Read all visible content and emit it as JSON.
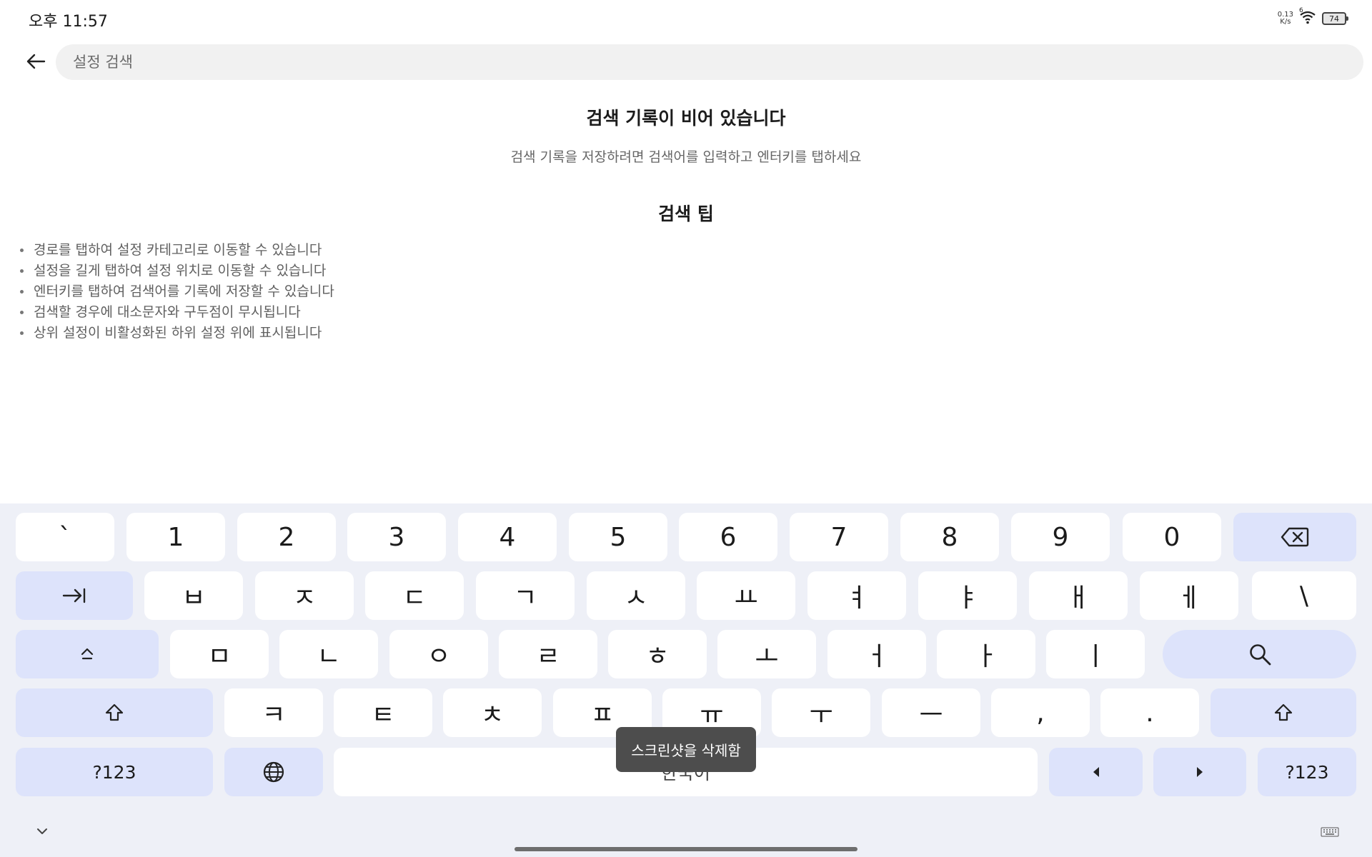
{
  "status_bar": {
    "time": "오후 11:57",
    "net_speed_value": "0.13",
    "net_speed_unit": "K/s",
    "wifi_badge": "6",
    "battery": "74"
  },
  "search": {
    "placeholder": "설정 검색"
  },
  "empty_state": {
    "title": "검색 기록이 비어 있습니다",
    "subtitle": "검색 기록을 저장하려면 검색어를 입력하고 엔터키를 탭하세요"
  },
  "tips": {
    "title": "검색 팁",
    "items": [
      "경로를 탭하여 설정 카테고리로 이동할 수 있습니다",
      "설정을 길게 탭하여 설정 위치로 이동할 수 있습니다",
      "엔터키를 탭하여 검색어를 기록에 저장할 수 있습니다",
      "검색할 경우에 대소문자와 구두점이 무시됩니다",
      "상위 설정이 비활성화된 하위 설정 위에 표시됩니다"
    ]
  },
  "keyboard": {
    "row1": [
      "`",
      "1",
      "2",
      "3",
      "4",
      "5",
      "6",
      "7",
      "8",
      "9",
      "0"
    ],
    "row2": [
      "ㅂ",
      "ㅈ",
      "ㄷ",
      "ㄱ",
      "ㅅ",
      "ㅛ",
      "ㅕ",
      "ㅑ",
      "ㅐ",
      "ㅔ",
      "\\"
    ],
    "row3": [
      "ㅁ",
      "ㄴ",
      "ㅇ",
      "ㄹ",
      "ㅎ",
      "ㅗ",
      "ㅓ",
      "ㅏ",
      "ㅣ"
    ],
    "row4": [
      "ㅋ",
      "ㅌ",
      "ㅊ",
      "ㅍ",
      "ㅠ",
      "ㅜ",
      "ㅡ",
      ",",
      "."
    ],
    "symbols_label": "?123",
    "space_label": "한국어"
  },
  "toast": {
    "text": "스크린샷을 삭제함"
  },
  "colors": {
    "keyboard_bg": "#eef0f7",
    "function_key": "#dde3fb",
    "toast_bg": "#4d4d4d"
  }
}
